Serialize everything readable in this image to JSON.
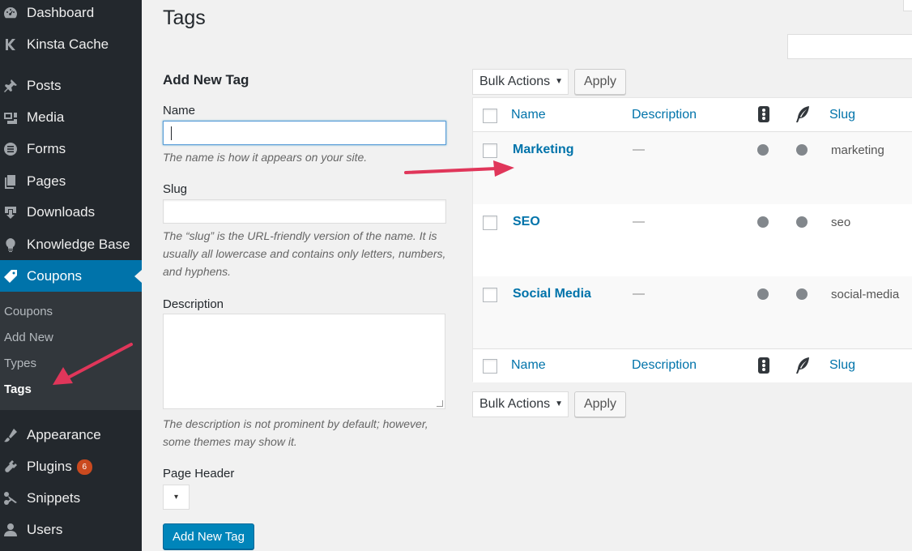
{
  "sidebar": {
    "items": [
      {
        "label": "Dashboard",
        "icon": "dashboard-icon"
      },
      {
        "label": "Kinsta Cache",
        "icon": "kinsta-k-icon"
      },
      {
        "label": "Posts",
        "icon": "pin-icon"
      },
      {
        "label": "Media",
        "icon": "media-icon"
      },
      {
        "label": "Forms",
        "icon": "forms-icon"
      },
      {
        "label": "Pages",
        "icon": "pages-icon"
      },
      {
        "label": "Downloads",
        "icon": "download-icon"
      },
      {
        "label": "Knowledge Base",
        "icon": "lightbulb-icon"
      },
      {
        "label": "Coupons",
        "icon": "tag-icon"
      },
      {
        "label": "Appearance",
        "icon": "brush-icon"
      },
      {
        "label": "Plugins",
        "icon": "plugin-icon",
        "badge": "6"
      },
      {
        "label": "Snippets",
        "icon": "scissors-icon"
      },
      {
        "label": "Users",
        "icon": "user-icon"
      }
    ],
    "submenu": [
      "Coupons",
      "Add New",
      "Types",
      "Tags"
    ]
  },
  "page": {
    "title": "Tags"
  },
  "form": {
    "heading": "Add New Tag",
    "name_label": "Name",
    "name_value": "",
    "name_help": "The name is how it appears on your site.",
    "slug_label": "Slug",
    "slug_value": "",
    "slug_help": "The “slug” is the URL-friendly version of the name. It is usually all lowercase and contains only letters, numbers, and hyphens.",
    "description_label": "Description",
    "description_help": "The description is not prominent by default; however, some themes may show it.",
    "page_header_label": "Page Header",
    "page_header_arrow": "▾",
    "submit_label": "Add New Tag"
  },
  "bulk": {
    "label": "Bulk Actions",
    "arrow": "▼",
    "apply": "Apply"
  },
  "table": {
    "columns": {
      "name": "Name",
      "description": "Description",
      "slug": "Slug"
    },
    "rows": [
      {
        "name": "Marketing",
        "description": "—",
        "slug": "marketing"
      },
      {
        "name": "SEO",
        "description": "—",
        "slug": "seo"
      },
      {
        "name": "Social Media",
        "description": "—",
        "slug": "social-media"
      }
    ]
  },
  "colors": {
    "sidebar_bg": "#23282d",
    "active": "#0073aa",
    "link": "#0073aa",
    "badge": "#ca4a1f",
    "annotation_arrow": "#e0365a"
  }
}
